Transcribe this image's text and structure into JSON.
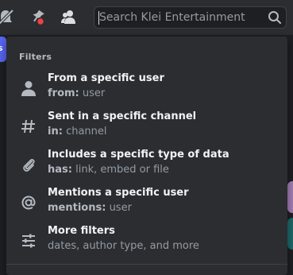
{
  "toolbar": {
    "icons": [
      "mute-bell-icon",
      "pin-icon",
      "members-icon"
    ]
  },
  "search": {
    "placeholder": "Search Klei Entertainment",
    "value": ""
  },
  "edge": {
    "badge_text": "s"
  },
  "popout": {
    "heading": "Filters",
    "items": [
      {
        "icon": "person-icon",
        "title": "From a specific user",
        "key": "from:",
        "value": "user"
      },
      {
        "icon": "hash-icon",
        "title": "Sent in a specific channel",
        "key": "in:",
        "value": "channel"
      },
      {
        "icon": "paperclip-icon",
        "title": "Includes a specific type of data",
        "key": "has:",
        "value": "link, embed or file"
      },
      {
        "icon": "at-icon",
        "title": "Mentions a specific user",
        "key": "mentions:",
        "value": "user"
      },
      {
        "icon": "sliders-icon",
        "title": "More filters",
        "key": "",
        "value": "dates, author type, and more"
      }
    ]
  },
  "colors": {
    "background": "#1e1f22",
    "panel": "#2b2d31",
    "accent": "#5865f2",
    "notification_red": "#f23f42",
    "text_primary": "#f2f3f5",
    "text_muted": "#949ba4"
  }
}
